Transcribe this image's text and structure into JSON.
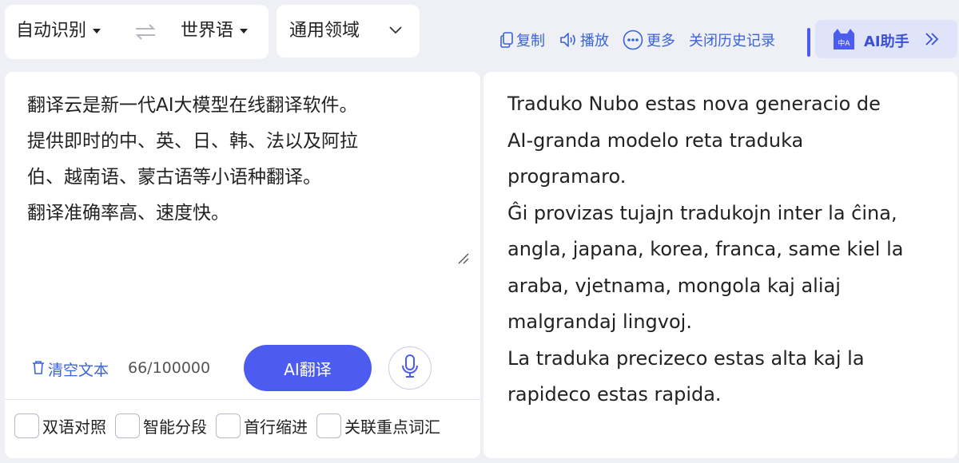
{
  "lang_bar": {
    "source_lang": "自动识别",
    "target_lang": "世界语",
    "domain": "通用领域"
  },
  "toolbar": {
    "copy_label": "复制",
    "play_label": "播放",
    "more_label": "更多",
    "history_label": "关闭历史记录",
    "ai_assistant_label": "AI助手",
    "ai_badge": "中A"
  },
  "source": {
    "lines": [
      "翻译云是新一代AI大模型在线翻译软件。",
      "提供即时的中、英、日、韩、法以及阿拉",
      "伯、越南语、蒙古语等小语种翻译。",
      "翻译准确率高、速度快。"
    ],
    "clear_label": "清空文本",
    "char_count": "66/100000",
    "translate_label": "AI翻译"
  },
  "options": [
    {
      "label": "双语对照",
      "checked": false
    },
    {
      "label": "智能分段",
      "checked": false
    },
    {
      "label": "首行缩进",
      "checked": false
    },
    {
      "label": "关联重点词汇",
      "checked": false
    }
  ],
  "target": {
    "lines": [
      "Traduko Nubo estas nova generacio de",
      "AI-granda modelo reta traduka",
      "programaro.",
      "Ĝi provizas tujajn tradukojn inter la ĉina,",
      "angla, japana, korea, franca, same kiel la",
      "araba, vjetnama, mongola kaj aliaj",
      "malgrandaj lingvoj.",
      "La traduka precizeco estas alta kaj la",
      "rapideco estas rapida."
    ]
  },
  "colors": {
    "accent": "#4c5bf0",
    "link": "#3a63d8",
    "background": "#eef0f5"
  }
}
